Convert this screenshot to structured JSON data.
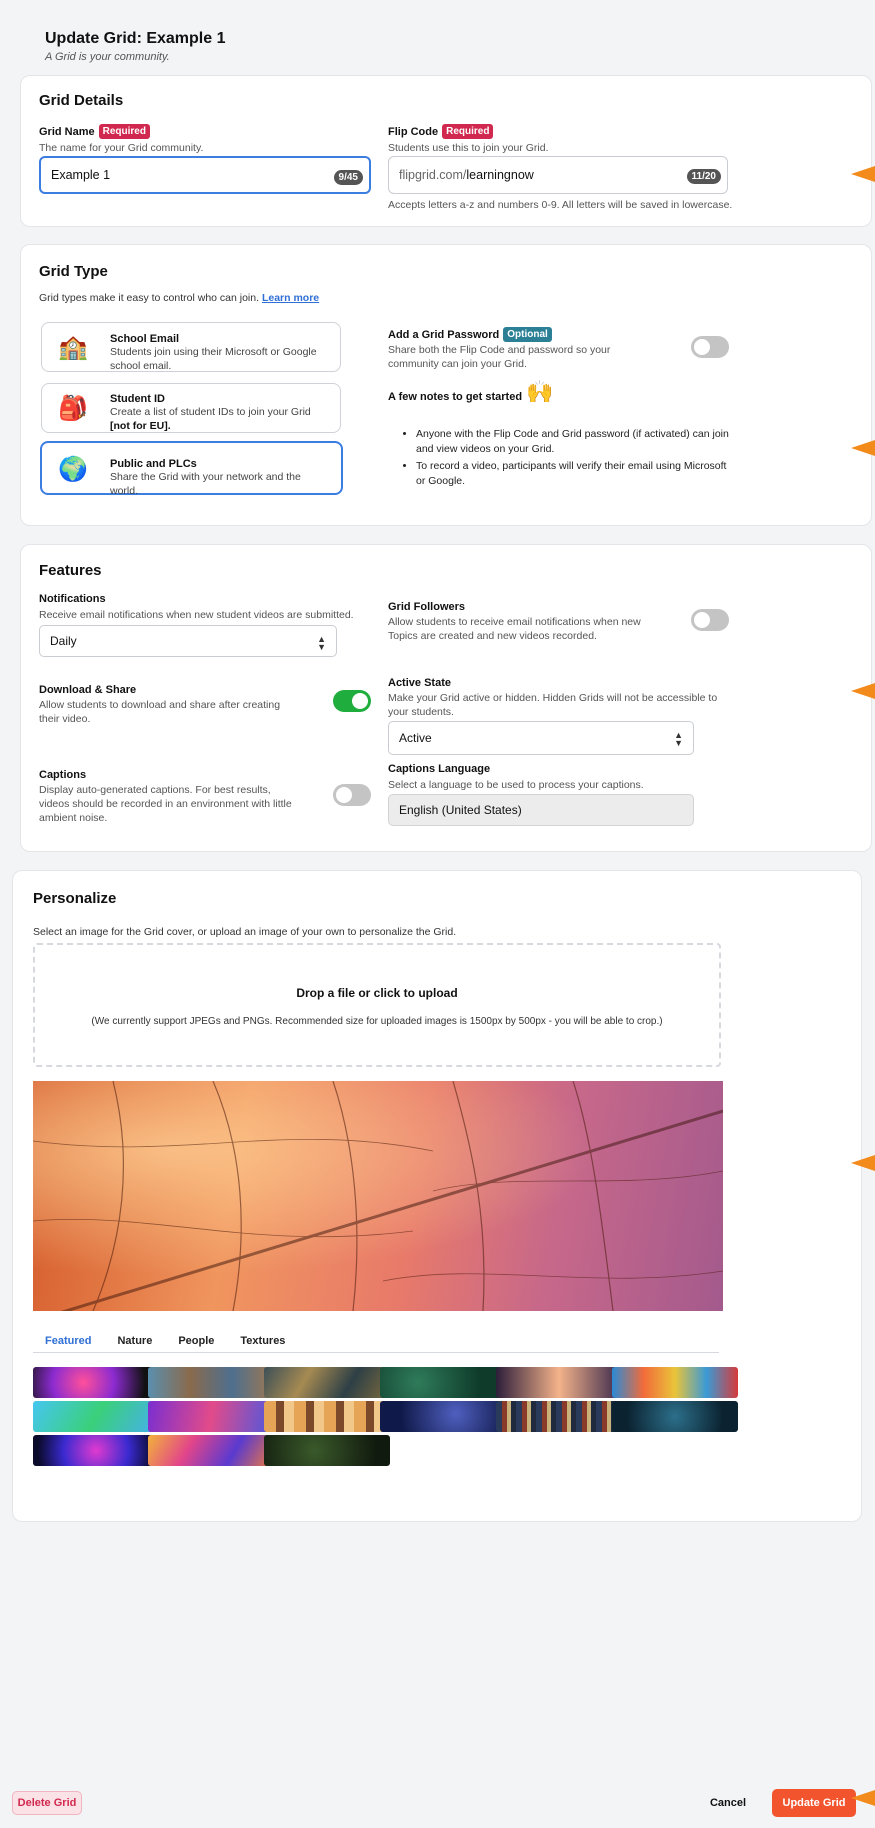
{
  "header": {
    "title": "Update Grid: Example 1",
    "subtitle": "A Grid is your community."
  },
  "grid_details": {
    "title": "Grid Details",
    "name_label": "Grid Name",
    "required_badge": "Required",
    "name_hint": "The name for your Grid community.",
    "name_value": "Example 1",
    "name_counter": "9/45",
    "flip_label": "Flip Code",
    "flip_hint": "Students use this to join your Grid.",
    "flip_prefix": "flipgrid.com/",
    "flip_value": "learningnow",
    "flip_counter": "11/20",
    "flip_note": "Accepts letters a-z and numbers 0-9. All letters will be saved in lowercase."
  },
  "grid_type": {
    "title": "Grid Type",
    "intro": "Grid types make it easy to control who can join.",
    "learn_more": "Learn more",
    "options": [
      {
        "icon": "school-icon",
        "glyph": "🏫",
        "title": "School Email",
        "desc": "Students join using their Microsoft or Google school email."
      },
      {
        "icon": "backpack-icon",
        "glyph": "🎒",
        "title": "Student ID",
        "desc": "Create a list of student IDs to join your Grid",
        "desc_bold": "[not for EU]."
      },
      {
        "icon": "globe-icon",
        "glyph": "🌍",
        "title": "Public and PLCs",
        "desc": "Share the Grid with your network and the world."
      }
    ],
    "password_label": "Add a Grid Password",
    "optional_badge": "Optional",
    "password_hint": "Share both the Flip Code and password so your community can join your Grid.",
    "notes_title": "A few notes to get started",
    "notes_emoji": "🙌",
    "notes": [
      "Anyone with the Flip Code and Grid password (if activated) can join and view videos on your Grid.",
      "To record a video, participants will verify their email using Microsoft or Google."
    ]
  },
  "features": {
    "title": "Features",
    "notifications_label": "Notifications",
    "notifications_hint": "Receive email notifications when new student videos are submitted.",
    "notifications_value": "Daily",
    "followers_label": "Grid Followers",
    "followers_hint": "Allow students to receive email notifications when new Topics are created and new videos recorded.",
    "download_label": "Download & Share",
    "download_hint": "Allow students to download and share after creating their video.",
    "active_label": "Active State",
    "active_hint": "Make your Grid active or hidden. Hidden Grids will not be accessible to your students.",
    "active_value": "Active",
    "captions_label": "Captions",
    "captions_hint": "Display auto-generated captions. For best results, videos should be recorded in an environment with little ambient noise.",
    "captions_lang_label": "Captions Language",
    "captions_lang_hint": "Select a language to be used to process your captions.",
    "captions_lang_value": "English (United States)",
    "followers_on": false,
    "download_on": true,
    "captions_on": false,
    "password_on": false
  },
  "personalize": {
    "title": "Personalize",
    "intro": "Select an image for the Grid cover, or upload an image of your own to personalize the Grid.",
    "drop_title": "Drop a file or click to upload",
    "drop_note": "(We currently support JPEGs and PNGs. Recommended size for uploaded images is 1500px by 500px - you will be able to crop.)",
    "tabs": [
      "Featured",
      "Nature",
      "People",
      "Textures"
    ],
    "thumbnail_count": 15
  },
  "footer": {
    "delete": "Delete Grid",
    "cancel": "Cancel",
    "update": "Update Grid"
  },
  "colors": {
    "accent": "#3b7de0",
    "required": "#d1284f",
    "optional": "#2b8096",
    "toggle_on": "#1fad3e",
    "update_button": "#f2542d",
    "arrow": "#f28a1c"
  }
}
